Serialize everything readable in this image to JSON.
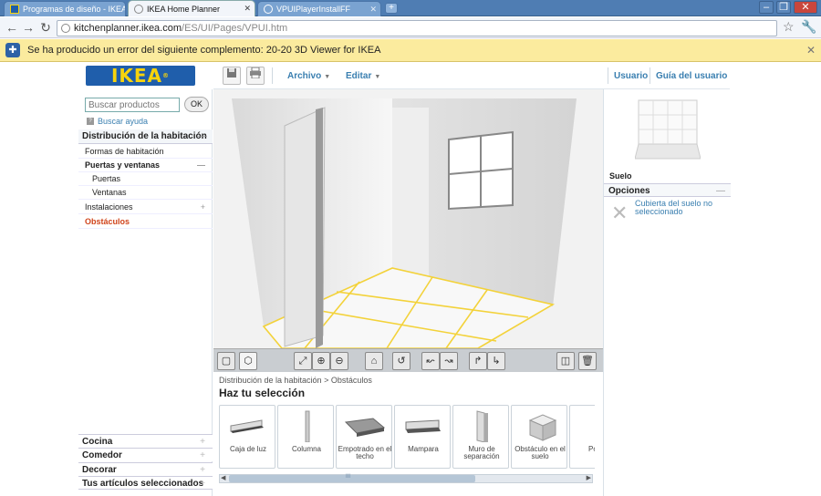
{
  "browser": {
    "tabs": [
      {
        "label": "Programas de diseño - IKEA",
        "active": false
      },
      {
        "label": "IKEA Home Planner",
        "active": true
      },
      {
        "label": "VPUIPlayerInstallFF",
        "active": false
      }
    ],
    "url_host": "kitchenplanner.ikea.com",
    "url_path": "/ES/UI/Pages/VPUI.htm",
    "infobar_text": "Se ha producido un error del siguiente complemento: 20-20 3D Viewer for IKEA"
  },
  "app": {
    "logo": "IKEA",
    "menus": {
      "archivo": "Archivo",
      "editar": "Editar",
      "usuario": "Usuario",
      "guia": "Guía del usuario"
    },
    "left": {
      "search_placeholder": "Buscar productos",
      "ok_label": "OK",
      "help_label": "Buscar ayuda",
      "section_title": "Distribución de la habitación",
      "items": [
        {
          "label": "Formas de habitación"
        },
        {
          "label": "Puertas y ventanas",
          "toggle": "—"
        },
        {
          "label": "Puertas"
        },
        {
          "label": "Ventanas"
        },
        {
          "label": "Instalaciones",
          "toggle": "+"
        },
        {
          "label": "Obstáculos"
        }
      ],
      "bottom_sections": [
        {
          "label": "Cocina"
        },
        {
          "label": "Comedor"
        },
        {
          "label": "Decorar"
        },
        {
          "label": "Tus artículos seleccionados"
        }
      ],
      "toggle_minus": "—",
      "toggle_plus": "+"
    },
    "selection": {
      "breadcrumb": "Distribución de la habitación > Obstáculos",
      "title": "Haz tu selección",
      "cards": [
        {
          "label": "Caja de luz"
        },
        {
          "label": "Columna"
        },
        {
          "label": "Empotrado en el techo"
        },
        {
          "label": "Mampara"
        },
        {
          "label": "Muro de separación"
        },
        {
          "label": "Obstáculo en el suelo"
        },
        {
          "label": "Po"
        }
      ],
      "scroll_handle": "III"
    },
    "right": {
      "floor_label": "Suelo",
      "options_title": "Opciones",
      "options_message": "Cubierta del suelo no seleccionado"
    },
    "colors": {
      "ikea_blue": "#1f5eab",
      "ikea_yellow": "#f7d30c",
      "link_blue": "#3a7fb0",
      "active_red": "#d0441c",
      "floor_lines": "#f3d23a"
    }
  }
}
